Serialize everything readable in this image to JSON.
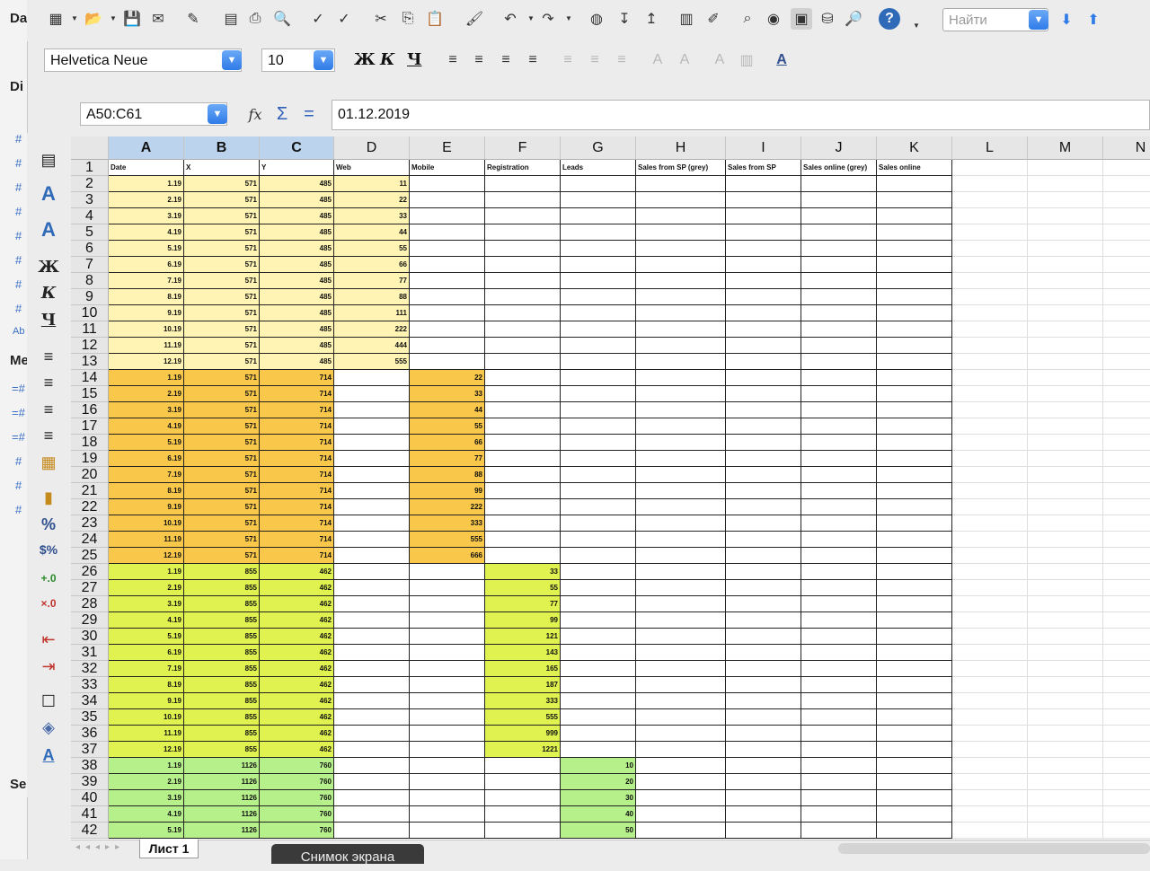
{
  "left_panel": {
    "items": [
      "Da",
      "Di",
      "Me",
      "Se"
    ],
    "small": [
      "#",
      "#",
      "#",
      "#",
      "#",
      "#",
      "#",
      "#",
      "Ab",
      "=#",
      "=#",
      "=#",
      "#",
      "#",
      "#"
    ]
  },
  "toolbar": {
    "find_placeholder": "Найти",
    "icons": [
      "new-icon",
      "open-icon",
      "save-icon",
      "email-icon",
      "edit-icon",
      "pdf-icon",
      "print-icon",
      "preview-icon",
      "spellcheck-icon",
      "autospell-icon",
      "cut-icon",
      "copy-icon",
      "paste-icon",
      "clone-format-icon",
      "undo-icon",
      "redo-icon",
      "navigator-icon",
      "sort-asc-icon",
      "sort-desc-icon",
      "chart-icon",
      "draw-icon",
      "find-replace-icon",
      "navigator2-icon",
      "gallery-icon",
      "datasource-icon",
      "zoom-icon",
      "help-icon"
    ]
  },
  "format_bar": {
    "font_name": "Helvetica Neue",
    "font_size": "10",
    "bold": "Ж",
    "italic": "К",
    "underline": "Ч"
  },
  "formula_bar": {
    "name_box": "A50:C61",
    "formula": "01.12.2019"
  },
  "side_toolbar": {
    "bold": "Ж",
    "italic": "К",
    "underline": "Ч",
    "percent": "%"
  },
  "columns": [
    "A",
    "B",
    "C",
    "D",
    "E",
    "F",
    "G",
    "H",
    "I",
    "J",
    "K",
    "L",
    "M",
    "N"
  ],
  "row_numbers": [
    "1",
    "2",
    "3",
    "4",
    "5",
    "6",
    "7",
    "8",
    "9",
    "10",
    "11",
    "12",
    "13",
    "14",
    "15",
    "16",
    "17",
    "18",
    "19",
    "20",
    "21",
    "22",
    "23",
    "24",
    "25",
    "26",
    "27",
    "28",
    "29",
    "30",
    "31",
    "32",
    "33",
    "34",
    "35",
    "36",
    "37",
    "38",
    "39",
    "40",
    "41",
    "42"
  ],
  "headers": [
    "Date",
    "X",
    "Y",
    "Web",
    "Mobile",
    "Registration",
    "Leads",
    "Sales from SP (grey)",
    "Sales from SP",
    "Sales online (grey)",
    "Sales online"
  ],
  "colors": {
    "web": "#fff4b3",
    "mobile": "#f9c84a",
    "registration": "#dff24f",
    "leads": "#b6f08a",
    "selection_header": "#bcd3ee"
  },
  "rows": [
    {
      "group": "web",
      "date": "1.19",
      "x": "571",
      "y": "485",
      "value": "11"
    },
    {
      "group": "web",
      "date": "2.19",
      "x": "571",
      "y": "485",
      "value": "22"
    },
    {
      "group": "web",
      "date": "3.19",
      "x": "571",
      "y": "485",
      "value": "33"
    },
    {
      "group": "web",
      "date": "4.19",
      "x": "571",
      "y": "485",
      "value": "44"
    },
    {
      "group": "web",
      "date": "5.19",
      "x": "571",
      "y": "485",
      "value": "55"
    },
    {
      "group": "web",
      "date": "6.19",
      "x": "571",
      "y": "485",
      "value": "66"
    },
    {
      "group": "web",
      "date": "7.19",
      "x": "571",
      "y": "485",
      "value": "77"
    },
    {
      "group": "web",
      "date": "8.19",
      "x": "571",
      "y": "485",
      "value": "88"
    },
    {
      "group": "web",
      "date": "9.19",
      "x": "571",
      "y": "485",
      "value": "111"
    },
    {
      "group": "web",
      "date": "10.19",
      "x": "571",
      "y": "485",
      "value": "222"
    },
    {
      "group": "web",
      "date": "11.19",
      "x": "571",
      "y": "485",
      "value": "444"
    },
    {
      "group": "web",
      "date": "12.19",
      "x": "571",
      "y": "485",
      "value": "555"
    },
    {
      "group": "mobile",
      "date": "1.19",
      "x": "571",
      "y": "714",
      "value": "22"
    },
    {
      "group": "mobile",
      "date": "2.19",
      "x": "571",
      "y": "714",
      "value": "33"
    },
    {
      "group": "mobile",
      "date": "3.19",
      "x": "571",
      "y": "714",
      "value": "44"
    },
    {
      "group": "mobile",
      "date": "4.19",
      "x": "571",
      "y": "714",
      "value": "55"
    },
    {
      "group": "mobile",
      "date": "5.19",
      "x": "571",
      "y": "714",
      "value": "66"
    },
    {
      "group": "mobile",
      "date": "6.19",
      "x": "571",
      "y": "714",
      "value": "77"
    },
    {
      "group": "mobile",
      "date": "7.19",
      "x": "571",
      "y": "714",
      "value": "88"
    },
    {
      "group": "mobile",
      "date": "8.19",
      "x": "571",
      "y": "714",
      "value": "99"
    },
    {
      "group": "mobile",
      "date": "9.19",
      "x": "571",
      "y": "714",
      "value": "222"
    },
    {
      "group": "mobile",
      "date": "10.19",
      "x": "571",
      "y": "714",
      "value": "333"
    },
    {
      "group": "mobile",
      "date": "11.19",
      "x": "571",
      "y": "714",
      "value": "555"
    },
    {
      "group": "mobile",
      "date": "12.19",
      "x": "571",
      "y": "714",
      "value": "666"
    },
    {
      "group": "registration",
      "date": "1.19",
      "x": "855",
      "y": "462",
      "value": "33"
    },
    {
      "group": "registration",
      "date": "2.19",
      "x": "855",
      "y": "462",
      "value": "55"
    },
    {
      "group": "registration",
      "date": "3.19",
      "x": "855",
      "y": "462",
      "value": "77"
    },
    {
      "group": "registration",
      "date": "4.19",
      "x": "855",
      "y": "462",
      "value": "99"
    },
    {
      "group": "registration",
      "date": "5.19",
      "x": "855",
      "y": "462",
      "value": "121"
    },
    {
      "group": "registration",
      "date": "6.19",
      "x": "855",
      "y": "462",
      "value": "143"
    },
    {
      "group": "registration",
      "date": "7.19",
      "x": "855",
      "y": "462",
      "value": "165"
    },
    {
      "group": "registration",
      "date": "8.19",
      "x": "855",
      "y": "462",
      "value": "187"
    },
    {
      "group": "registration",
      "date": "9.19",
      "x": "855",
      "y": "462",
      "value": "333"
    },
    {
      "group": "registration",
      "date": "10.19",
      "x": "855",
      "y": "462",
      "value": "555"
    },
    {
      "group": "registration",
      "date": "11.19",
      "x": "855",
      "y": "462",
      "value": "999"
    },
    {
      "group": "registration",
      "date": "12.19",
      "x": "855",
      "y": "462",
      "value": "1221"
    },
    {
      "group": "leads",
      "date": "1.19",
      "x": "1126",
      "y": "760",
      "value": "10"
    },
    {
      "group": "leads",
      "date": "2.19",
      "x": "1126",
      "y": "760",
      "value": "20"
    },
    {
      "group": "leads",
      "date": "3.19",
      "x": "1126",
      "y": "760",
      "value": "30"
    },
    {
      "group": "leads",
      "date": "4.19",
      "x": "1126",
      "y": "760",
      "value": "40"
    },
    {
      "group": "leads",
      "date": "5.19",
      "x": "1126",
      "y": "760",
      "value": "50"
    }
  ],
  "sheet_tab": "Лист 1",
  "snapshot_label": "Снимок экрана"
}
